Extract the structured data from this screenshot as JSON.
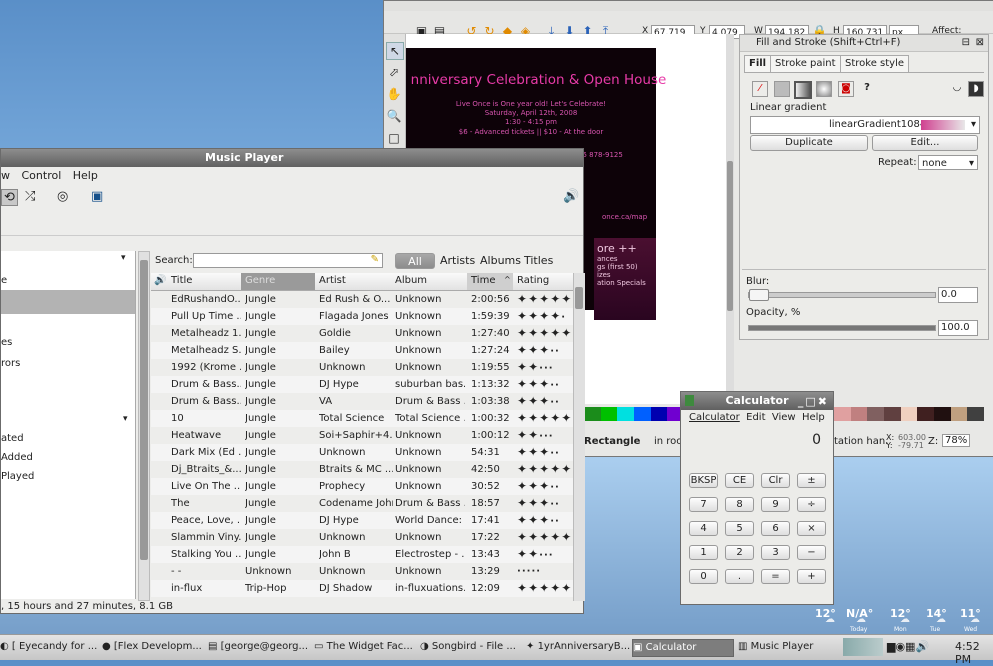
{
  "inkscape": {
    "coords": {
      "x_label": "X",
      "x": "67.719",
      "y_label": "Y",
      "y": "4.079",
      "w_label": "W",
      "w": "194.182",
      "h_label": "H",
      "h": "160.731",
      "unit": "px",
      "affect": "Affect:"
    },
    "poster": {
      "title": "nniversary Celebration & Open House",
      "lines": [
        "Live Once is One year old!  Let's Celebrate!",
        "Saturday, April 12th, 2008",
        "1:30 - 4:15 pm",
        "$6 - Advanced tickets  ||  $10 - At the door",
        "tickets online at www.LiveOnce.ca/store or call 905 878-9125"
      ],
      "map_text": "once.ca/map",
      "box_title": "ore ++",
      "box_lines": [
        "ances",
        "gs (first 50)",
        "izes",
        "ation Specials"
      ]
    },
    "status": {
      "object": "Rectangle",
      "in_text": "in roo",
      "rotation": "tation han.",
      "x_label": "X:",
      "x": "603.00",
      "y_label": "Y:",
      "y": "-79.71",
      "z_label": "Z:",
      "zoom": "78%"
    },
    "palette": [
      "#1b8c1b",
      "#00c000",
      "#00e0e0",
      "#0060ff",
      "#0000b0",
      "#7000d0",
      "#ff00ff",
      "#f0f0f0",
      "#000000",
      "#ffff00",
      "#ff8c00",
      "#ff2020",
      "#a00000",
      "#ff9090",
      "#ffc0c0",
      "#e0a0a0",
      "#c08080",
      "#806060",
      "#604040",
      "#f0d0c0",
      "#402020",
      "#201010",
      "#c0a080",
      "#404040"
    ]
  },
  "fillstroke": {
    "title": "Fill and Stroke (Shift+Ctrl+F)",
    "tabs": [
      "Fill",
      "Stroke paint",
      "Stroke style"
    ],
    "gradient_type": "Linear gradient",
    "gradient_name": "linearGradient10845",
    "duplicate": "Duplicate",
    "edit": "Edit...",
    "repeat_label": "Repeat:",
    "repeat_value": "none",
    "blur_label": "Blur:",
    "blur_value": "0.0",
    "opacity_label": "Opacity, %",
    "opacity_value": "100.0",
    "opacity_level": 1.0,
    "blur_level": 0.0
  },
  "music": {
    "title": "Music Player",
    "menu": [
      "w",
      "Control",
      "Help"
    ],
    "left_items_a": [
      "e",
      "es",
      "rors"
    ],
    "left_items_b": [
      "ated",
      "Added",
      "Played"
    ],
    "search_label": "Search:",
    "filters": [
      "All",
      "Artists",
      "Albums",
      "Titles"
    ],
    "columns": [
      "Title",
      "Genre",
      "Artist",
      "Album",
      "Time",
      "Rating"
    ],
    "rows": [
      {
        "title": "EdRushandO...",
        "genre": "Jungle",
        "artist": "Ed Rush & O...",
        "album": "Unknown",
        "time": "2:00:56",
        "rating": 5
      },
      {
        "title": "Pull Up Time ...",
        "genre": "Jungle",
        "artist": "Flagada Jones",
        "album": "Unknown",
        "time": "1:59:39",
        "rating": 4
      },
      {
        "title": "Metalheadz 1...",
        "genre": "Jungle",
        "artist": "Goldie",
        "album": "Unknown",
        "time": "1:27:40",
        "rating": 5
      },
      {
        "title": "Metalheadz S...",
        "genre": "Jungle",
        "artist": "Bailey",
        "album": "Unknown",
        "time": "1:27:24",
        "rating": 3
      },
      {
        "title": "1992 (Krome ...",
        "genre": "Jungle",
        "artist": "Unknown",
        "album": "Unknown",
        "time": "1:19:55",
        "rating": 2
      },
      {
        "title": "Drum & Bass...",
        "genre": "Jungle",
        "artist": "DJ Hype",
        "album": "suburban bas...",
        "time": "1:13:32",
        "rating": 3
      },
      {
        "title": "Drum & Bass...",
        "genre": "Jungle",
        "artist": "VA",
        "album": "Drum & Bass ...",
        "time": "1:03:38",
        "rating": 3
      },
      {
        "title": "10",
        "genre": "Jungle",
        "artist": "Total Science",
        "album": "Total Science ...",
        "time": "1:00:32",
        "rating": 5
      },
      {
        "title": "Heatwave",
        "genre": "Jungle",
        "artist": "Soi+Saphir+4...",
        "album": "Unknown",
        "time": "1:00:12",
        "rating": 2
      },
      {
        "title": "Dark Mix (Ed ...",
        "genre": "Jungle",
        "artist": "Unknown",
        "album": "Unknown",
        "time": "54:31",
        "rating": 3
      },
      {
        "title": "Dj_Btraits_&...",
        "genre": "Jungle",
        "artist": "Btraits & MC ...",
        "album": "Unknown",
        "time": "42:50",
        "rating": 5
      },
      {
        "title": "Live On The ...",
        "genre": "Jungle",
        "artist": "Prophecy",
        "album": "Unknown",
        "time": "30:52",
        "rating": 3
      },
      {
        "title": "The",
        "genre": "Jungle",
        "artist": "Codename John",
        "album": "Drum & Bass ...",
        "time": "18:57",
        "rating": 3
      },
      {
        "title": "Peace, Love, ...",
        "genre": "Jungle",
        "artist": "DJ Hype",
        "album": "World Dance: ...",
        "time": "17:41",
        "rating": 3
      },
      {
        "title": "Slammin Viny...",
        "genre": "Jungle",
        "artist": "Unknown",
        "album": "Unknown",
        "time": "17:22",
        "rating": 5
      },
      {
        "title": "Stalking You ...",
        "genre": "Jungle",
        "artist": "John B",
        "album": "Electrostep - ...",
        "time": "13:43",
        "rating": 2
      },
      {
        "title": "- -",
        "genre": "Unknown",
        "artist": "Unknown",
        "album": "Unknown",
        "time": "13:29",
        "rating": 0
      },
      {
        "title": "in-flux",
        "genre": "Trip-Hop",
        "artist": "DJ Shadow",
        "album": "in-fluxuations...",
        "time": "12:09",
        "rating": 5
      }
    ],
    "status": ", 15 hours and 27 minutes, 8.1 GB"
  },
  "calculator": {
    "title": "Calculator",
    "menu": [
      "Calculator",
      "Edit",
      "View",
      "Help"
    ],
    "display": "0",
    "buttons": [
      [
        "BKSP",
        "CE",
        "Clr",
        "±"
      ],
      [
        "7",
        "8",
        "9",
        "÷"
      ],
      [
        "4",
        "5",
        "6",
        "×"
      ],
      [
        "1",
        "2",
        "3",
        "−"
      ],
      [
        "0",
        ".",
        "=",
        "+"
      ]
    ]
  },
  "weather": [
    {
      "temp": "12°",
      "label": ""
    },
    {
      "temp": "N/A°",
      "label": "Today"
    },
    {
      "temp": "12°",
      "label": "Mon"
    },
    {
      "temp": "14°",
      "label": "Tue"
    },
    {
      "temp": "11°",
      "label": "Wed"
    }
  ],
  "taskbar": {
    "tasks": [
      "[ Eyecandy for ...",
      "[Flex Developm...",
      "[george@georg...",
      "The Widget Fac...",
      "Songbird - File ...",
      "1yrAnniversaryB...",
      "Calculator",
      "Music Player"
    ],
    "clock": "4:52 PM"
  },
  "colors": {
    "accent": "#e83ba8",
    "active_task": "#7d7d7d"
  }
}
